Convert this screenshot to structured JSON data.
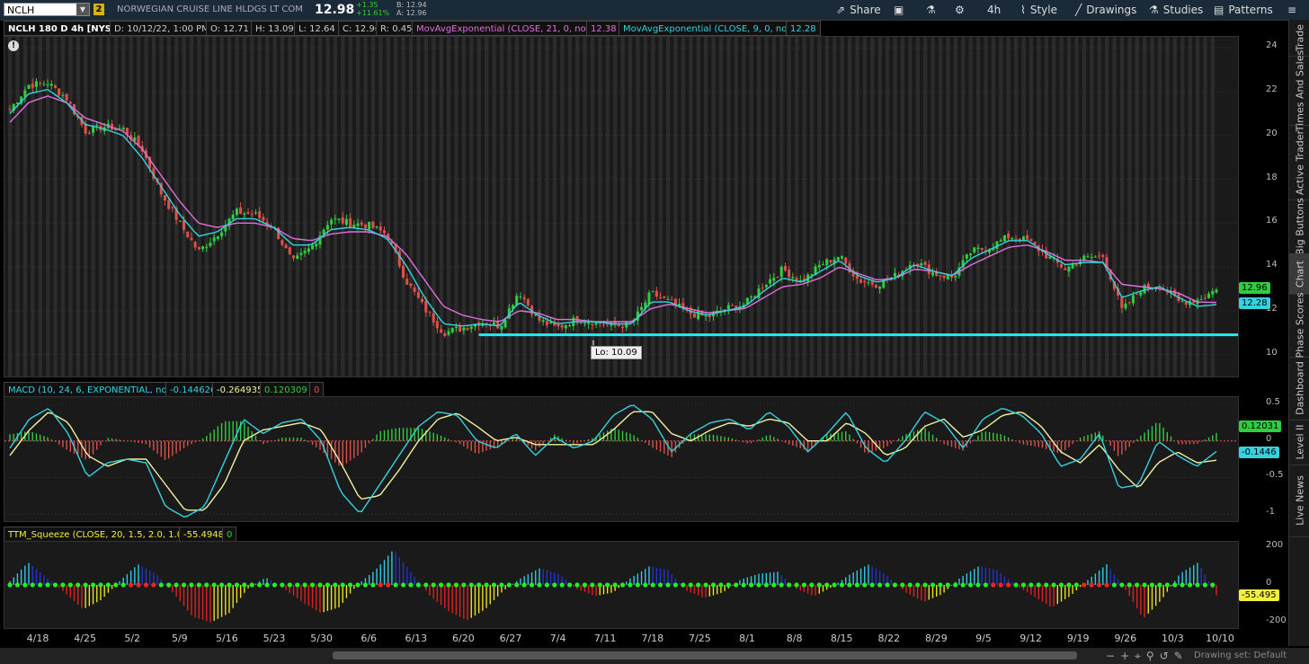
{
  "header": {
    "symbol": "NCLH",
    "link_group": "2",
    "company_name": "NORWEGIAN CRUISE LINE HLDGS LT COM",
    "last": "12.98",
    "net_change": "+1.35",
    "pct_change": "+11.61%",
    "bid": "B: 12.94",
    "ask": "A: 12.96",
    "toolbar": {
      "share": "Share",
      "timeframe": "4h",
      "style": "Style",
      "drawings": "Drawings",
      "studies": "Studies",
      "patterns": "Patterns"
    }
  },
  "info": {
    "chart_title": "NCLH 180 D 4h [NYSE]",
    "date": "D: 10/12/22, 1:00 PM",
    "open": "O: 12.71",
    "high": "H: 13.09",
    "low": "L: 12.64",
    "close": "C: 12.96",
    "range": "R: 0.45",
    "ema21_label": "MovAvgExponential (CLOSE, 21, 0, no)",
    "ema21_value": "12.38",
    "ema9_label": "MovAvgExponential (CLOSE, 9, 0, no)",
    "ema9_value": "12.28"
  },
  "macd": {
    "label": "MACD (10, 24, 6, EXPONENTIAL, no)",
    "value": "-0.144626",
    "avg": "-0.264935",
    "diff": "0.120309",
    "zero": "0",
    "tag_diff": "0.12031",
    "tag_value": "-0.1446"
  },
  "ttm": {
    "label": "TTM_Squeeze (CLOSE, 20, 1.5, 2.0, 1.0)",
    "value": "-55.4948",
    "zero": "0",
    "tag_value": "-55.495"
  },
  "price_tags": {
    "close": "12.96",
    "ema9": "12.28"
  },
  "low_label": "Lo: 10.09",
  "sidebar": [
    "Trade",
    "Times And Sales",
    "Active Trader",
    "Big Buttons",
    "Chart",
    "Phase Scores",
    "Dashboard",
    "Level II",
    "Live News"
  ],
  "footer": {
    "drawing_set": "Drawing set: Default"
  },
  "colors": {
    "ema9": "#34d3e0",
    "ema21": "#e070e0",
    "support": "#2ee6f0",
    "up": "#2fce3f",
    "down": "#e0504a"
  },
  "chart_data": [
    {
      "type": "candlestick",
      "title": "NCLH 180 D 4h [NYSE]",
      "ylim": [
        9,
        24.5
      ],
      "yticks": [
        10,
        12,
        14,
        16,
        18,
        20,
        22,
        24
      ],
      "xticks": [
        "4/18",
        "4/25",
        "5/2",
        "5/9",
        "5/16",
        "5/23",
        "5/30",
        "6/6",
        "6/13",
        "6/20",
        "6/27",
        "7/4",
        "7/11",
        "7/18",
        "7/25",
        "8/1",
        "8/8",
        "8/15",
        "8/22",
        "8/29",
        "9/5",
        "9/12",
        "9/19",
        "9/26",
        "10/3",
        "10/10"
      ],
      "close_path": [
        21.2,
        22.3,
        22.4,
        21.7,
        20.2,
        20.4,
        20.3,
        19.4,
        17.4,
        16.0,
        14.7,
        15.5,
        16.5,
        16.4,
        15.8,
        14.2,
        14.9,
        16.2,
        16.0,
        15.9,
        15.5,
        13.4,
        12.1,
        11.0,
        11.2,
        11.5,
        11.3,
        12.9,
        11.6,
        11.2,
        11.6,
        11.5,
        11.3,
        11.4,
        12.8,
        12.4,
        11.9,
        11.7,
        12.1,
        12.3,
        13.2,
        13.9,
        13.3,
        14.1,
        14.5,
        13.4,
        13.2,
        13.6,
        14.3,
        13.7,
        13.5,
        14.7,
        14.9,
        15.4,
        15.2,
        14.5,
        13.9,
        14.4,
        14.5,
        12.0,
        13.0,
        13.2,
        12.4,
        12.5,
        12.96
      ],
      "ema9_path": [
        21.0,
        21.9,
        22.1,
        21.5,
        20.5,
        20.3,
        20.0,
        19.0,
        17.7,
        16.4,
        15.4,
        15.6,
        16.2,
        16.2,
        15.8,
        15.0,
        15.0,
        15.7,
        15.8,
        15.7,
        15.3,
        14.1,
        12.6,
        11.4,
        11.3,
        11.4,
        11.3,
        12.4,
        11.8,
        11.4,
        11.5,
        11.5,
        11.4,
        11.4,
        12.4,
        12.4,
        12.0,
        11.8,
        12.0,
        12.2,
        12.9,
        13.5,
        13.3,
        13.8,
        14.3,
        13.6,
        13.3,
        13.5,
        14.1,
        13.8,
        13.6,
        14.4,
        14.8,
        15.2,
        15.2,
        14.6,
        14.1,
        14.2,
        14.2,
        12.6,
        12.9,
        13.1,
        12.6,
        12.2,
        12.28
      ],
      "ema21_path": [
        20.6,
        21.5,
        21.8,
        21.5,
        20.8,
        20.5,
        20.2,
        19.4,
        18.2,
        17.0,
        16.0,
        15.8,
        16.0,
        16.0,
        15.8,
        15.3,
        15.2,
        15.5,
        15.6,
        15.6,
        15.4,
        14.6,
        13.4,
        12.2,
        11.8,
        11.6,
        11.5,
        12.0,
        11.9,
        11.6,
        11.6,
        11.5,
        11.5,
        11.5,
        12.1,
        12.3,
        12.1,
        11.9,
        12.0,
        12.1,
        12.6,
        13.1,
        13.2,
        13.5,
        14.0,
        13.7,
        13.4,
        13.5,
        13.9,
        13.8,
        13.6,
        14.1,
        14.5,
        14.9,
        15.0,
        14.7,
        14.3,
        14.3,
        14.2,
        13.2,
        13.1,
        13.0,
        12.8,
        12.4,
        12.38
      ],
      "support_level": 10.9,
      "low": 10.09,
      "last": 12.96,
      "ema9_last": 12.28,
      "ema21_last": 12.38
    },
    {
      "type": "line",
      "title": "MACD (10, 24, 6, EXPONENTIAL, no)",
      "ylim": [
        -1.1,
        0.6
      ],
      "yticks": [
        0.5,
        0,
        -0.5,
        -1
      ],
      "value_path": [
        -0.1,
        0.3,
        0.45,
        0.1,
        -0.5,
        -0.3,
        -0.25,
        -0.3,
        -0.9,
        -1.05,
        -0.9,
        -0.3,
        0.3,
        0.1,
        0.25,
        0.3,
        0.0,
        -0.7,
        -1.0,
        -0.6,
        -0.2,
        0.2,
        0.4,
        0.35,
        0.0,
        -0.1,
        0.1,
        -0.2,
        0.05,
        -0.1,
        0.0,
        0.35,
        0.5,
        0.3,
        -0.15,
        0.1,
        0.25,
        0.3,
        0.15,
        0.4,
        0.2,
        -0.15,
        0.1,
        0.4,
        -0.1,
        -0.3,
        0.0,
        0.4,
        0.25,
        -0.1,
        0.3,
        0.45,
        0.35,
        0.1,
        -0.35,
        -0.25,
        0.1,
        -0.65,
        -0.6,
        0.0,
        -0.2,
        -0.35,
        -0.1446
      ],
      "avg_path": [
        -0.2,
        0.15,
        0.4,
        0.25,
        -0.2,
        -0.35,
        -0.25,
        -0.25,
        -0.6,
        -0.95,
        -0.95,
        -0.6,
        0.0,
        0.15,
        0.2,
        0.25,
        0.15,
        -0.3,
        -0.8,
        -0.75,
        -0.4,
        0.0,
        0.3,
        0.38,
        0.2,
        0.0,
        0.05,
        -0.05,
        -0.05,
        -0.05,
        -0.05,
        0.15,
        0.4,
        0.4,
        0.1,
        0.0,
        0.15,
        0.25,
        0.2,
        0.3,
        0.25,
        0.0,
        0.0,
        0.25,
        0.1,
        -0.2,
        -0.1,
        0.2,
        0.3,
        0.05,
        0.15,
        0.35,
        0.4,
        0.2,
        -0.15,
        -0.3,
        -0.05,
        -0.4,
        -0.65,
        -0.3,
        -0.15,
        -0.3,
        -0.2649
      ]
    },
    {
      "type": "bar",
      "title": "TTM_Squeeze (CLOSE, 20, 1.5, 2.0, 1.0)",
      "ylim": [
        -230,
        230
      ],
      "yticks": [
        200,
        0,
        -200
      ],
      "value_path": [
        20,
        120,
        40,
        -40,
        -130,
        -80,
        20,
        110,
        60,
        -50,
        -170,
        -200,
        -150,
        -20,
        40,
        -20,
        -90,
        -150,
        -120,
        0,
        80,
        190,
        60,
        -60,
        -140,
        -190,
        -130,
        -30,
        40,
        90,
        60,
        -20,
        -60,
        -40,
        40,
        100,
        80,
        -30,
        -70,
        -40,
        30,
        60,
        70,
        -20,
        -60,
        -10,
        60,
        110,
        50,
        -40,
        -90,
        -50,
        40,
        100,
        80,
        0,
        -60,
        -120,
        -60,
        30,
        110,
        -20,
        -180,
        -80,
        60,
        120,
        -55
      ]
    }
  ]
}
